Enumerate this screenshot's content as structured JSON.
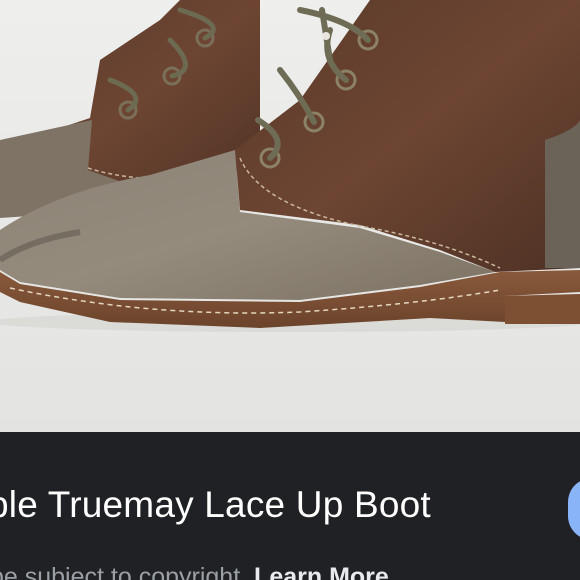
{
  "product": {
    "image_alt": "Brown leather and suede lace up boot",
    "title": "ple Truemay Lace Up Boot"
  },
  "notice": {
    "text": "be subject to copyright.",
    "link": "Learn More"
  },
  "side_button": {
    "icon": "circle-button-icon",
    "color": "#8ab4f8"
  },
  "colors": {
    "panel_background": "#202124",
    "title_text": "#ffffff",
    "secondary_text": "#9aa0a6"
  }
}
